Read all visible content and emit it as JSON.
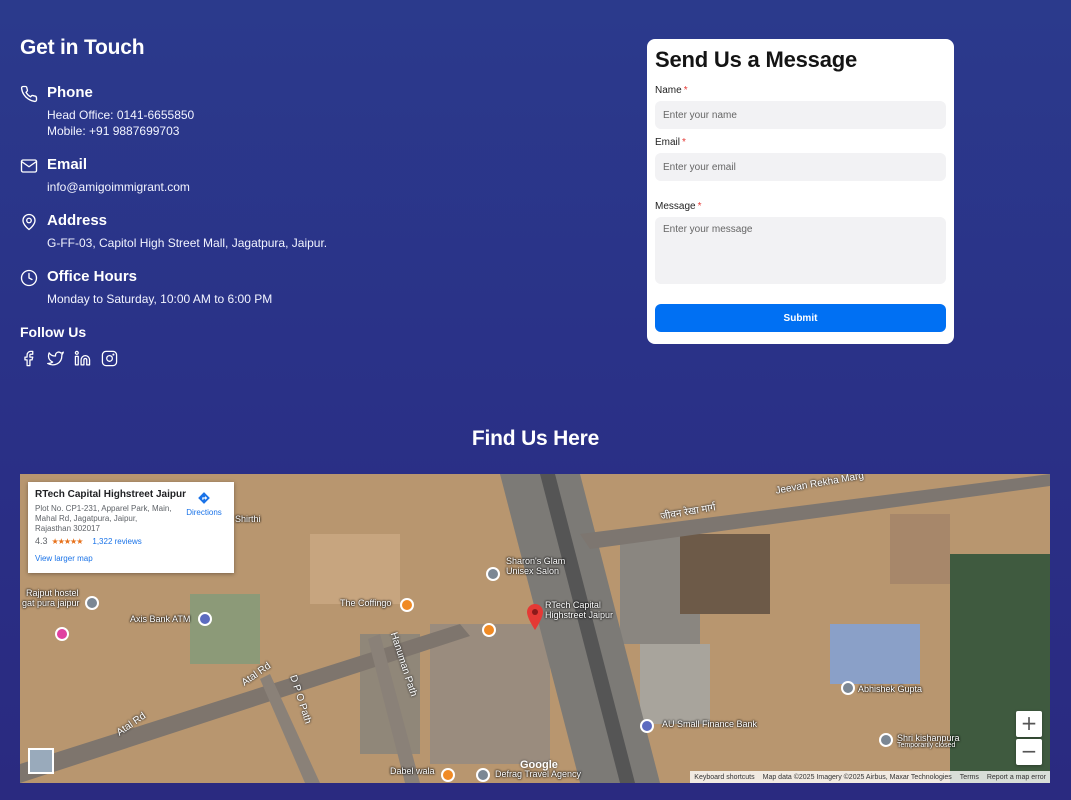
{
  "contact": {
    "title": "Get in Touch",
    "phone": {
      "heading": "Phone",
      "line1": "Head Office: 0141-6655850",
      "line2": "Mobile: +91 9887699703",
      "icon": "phone-icon"
    },
    "email": {
      "heading": "Email",
      "value": "info@amigoimmigrant.com",
      "icon": "mail-icon"
    },
    "address": {
      "heading": "Address",
      "value": "G-FF-03, Capitol High Street Mall, Jagatpura, Jaipur.",
      "icon": "map-pin-icon"
    },
    "hours": {
      "heading": "Office Hours",
      "value": "Monday to Saturday, 10:00 AM to 6:00 PM",
      "icon": "clock-icon"
    },
    "follow": {
      "heading": "Follow Us",
      "icons": [
        "facebook-icon",
        "twitter-icon",
        "linkedin-icon",
        "instagram-icon"
      ]
    }
  },
  "form": {
    "title": "Send Us a Message",
    "name_label": "Name",
    "name_placeholder": "Enter your name",
    "email_label": "Email",
    "email_placeholder": "Enter your email",
    "message_label": "Message",
    "message_placeholder": "Enter your message",
    "required_mark": "*",
    "submit_label": "Submit"
  },
  "map_section": {
    "title": "Find Us Here",
    "place": {
      "name": "RTech Capital Highstreet Jaipur",
      "address": "Plot No. CP1-231, Apparel Park, Main, Mahal Rd, Jagatpura, Jaipur, Rajasthan 302017",
      "rating": "4.3",
      "stars": "★★★★★",
      "reviews": "1,322 reviews",
      "directions": "Directions",
      "larger_map": "View larger map"
    },
    "labels": {
      "jeevan": "Jeevan Rekha Marg",
      "jeevan_hindi": "जीवन रेखा मार्ग",
      "shirthi": "Shirthi",
      "rajput": "Rajput hostel",
      "rajput2": "gat pura jaipur",
      "axis": "Axis Bank ATM",
      "coffingo": "The Coffingo",
      "sharon": "Sharon's Glam",
      "sharon2": "Unisex Salon",
      "rtech": "RTech Capital",
      "rtech2": "Highstreet Jaipur",
      "atal1": "Atal Rd",
      "atal2": "Atal Rd",
      "dpo": "D P O Path",
      "hanuman": "Hanuman Path",
      "au": "AU Small Finance Bank",
      "abhishek": "Abhishek Gupta",
      "shri": "Shri kishanpura",
      "shri2": "Temporarily closed",
      "dabel": "Dabel wala",
      "defrag": "Defrag Travel Agency",
      "google": "Google"
    },
    "attribution": {
      "shortcuts": "Keyboard shortcuts",
      "data": "Map data ©2025 Imagery ©2025 Airbus, Maxar Technologies",
      "terms": "Terms",
      "report": "Report a map error"
    },
    "zoom_in": "+",
    "zoom_out": "−"
  },
  "colors": {
    "background": "#2b3a8c",
    "card": "#ffffff",
    "submit": "#0070f3",
    "required": "#e53935",
    "link": "#1a73e8"
  }
}
